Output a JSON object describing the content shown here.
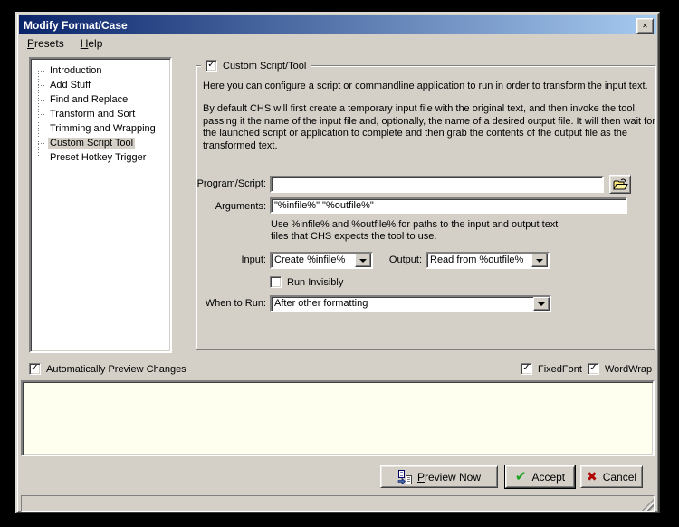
{
  "window": {
    "title": "Modify Format/Case"
  },
  "icons": {
    "close": "✕",
    "check": "✓",
    "accept_check": "✔",
    "cancel_x": "✖",
    "combo_arrow": "chevron-down",
    "browse": "folder-open",
    "preview": "preview-pages"
  },
  "colors": {
    "titlebar_left": "#0a246a",
    "titlebar_right": "#a6caf0",
    "window_face": "#d4d0c8",
    "preview_bg": "#fffff0",
    "accept_green": "#1ea321",
    "cancel_red": "#b00000",
    "folder_yellow": "#ffe97a"
  },
  "menu": {
    "presets_pre": "P",
    "presets_rest": "resets",
    "help_pre": "H",
    "help_rest": "elp"
  },
  "sidebar": {
    "items": [
      "Introduction",
      "Add Stuff",
      "Find and Replace",
      "Transform and Sort",
      "Trimming and Wrapping",
      "Custom Script Tool",
      "Preset Hotkey Trigger"
    ],
    "selected": "Custom Script Tool"
  },
  "main": {
    "group_label": "Custom Script/Tool",
    "group_checked": true,
    "para1": "Here you can configure a script or commandline application to run in order to transform the input text.",
    "para2": "By default CHS will first create a temporary input file with the original text, and then invoke the tool, passing it the name of the input file and, optionally, the name of a desired output file.  It will then wait for the launched script or application to complete and then grab the contents of the output file as the transformed text.",
    "program_label": "Program/Script:",
    "program_value": "",
    "arguments_label": "Arguments:",
    "arguments_value": "\"%infile%\" \"%outfile%\"",
    "note_line1": "Use %infile% and %outfile% for paths to the input and output text",
    "note_line2": "files that CHS expects the tool to use.",
    "input_label": "Input:",
    "input_value": "Create %infile%",
    "output_label": "Output:",
    "output_value": "Read from %outfile%",
    "run_invisibly_label": "Run Invisibly",
    "run_invisibly_checked": false,
    "when_label": "When to Run:",
    "when_value": "After other formatting"
  },
  "bottom": {
    "auto_preview_label": "Automatically Preview Changes",
    "auto_preview_checked": true,
    "fixedfont_label": "FixedFont",
    "fixedfont_checked": true,
    "wordwrap_label": "WordWrap",
    "wordwrap_checked": true,
    "preview_text": ""
  },
  "buttons": {
    "preview_pre": "P",
    "preview_rest": "review Now",
    "accept_label": "Accept",
    "cancel_label": "Cancel"
  }
}
